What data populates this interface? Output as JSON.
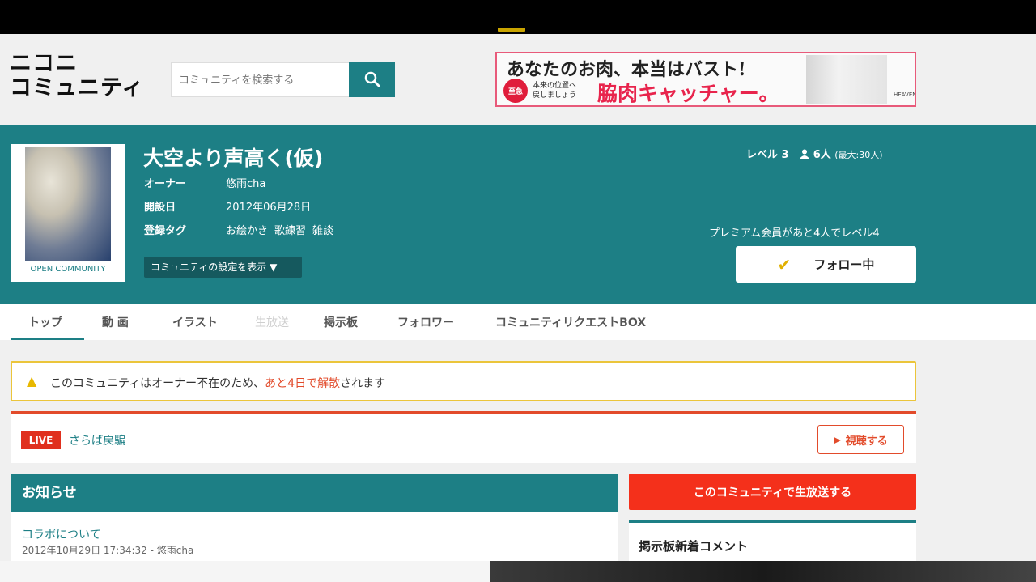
{
  "header": {
    "logo_line1": "ニコニ",
    "logo_line2": "コミュニティ",
    "search_placeholder": "コミュニティを検索する",
    "search_icon": "search-icon"
  },
  "ad": {
    "title": "あなたのお肉、本当はバスト!",
    "badge": "至急",
    "sub_line1": "本来の位置へ",
    "sub_line2": "戻しましょう",
    "cta": "脇肉キャッチャー。",
    "brand": "HEAVEN"
  },
  "community": {
    "title": "大空より声高く(仮)",
    "thumb_caption": "OPEN COMMUNITY",
    "owner_label": "オーナー",
    "owner": "悠雨cha",
    "founded_label": "開設日",
    "founded": "2012年06月28日",
    "tags_label": "登録タグ",
    "tags": [
      "お絵かき",
      "歌練習",
      "雑談"
    ],
    "settings_button": "コミュニティの設定を表示 ▼",
    "level": "レベル 3",
    "members": "6人",
    "members_max": "(最大:30人)",
    "premium_text": "プレミアム会員があと4人でレベル4",
    "follow_button": "フォロー中",
    "accent_color": "#1d7f85"
  },
  "tabs": [
    {
      "label": "トップ",
      "active": true
    },
    {
      "label": "動 画"
    },
    {
      "label": "イラスト"
    },
    {
      "label": "生放送",
      "disabled": true
    },
    {
      "label": "掲示板"
    },
    {
      "label": "フォロワー"
    },
    {
      "label": "コミュニティリクエストBOX"
    }
  ],
  "notice": {
    "before": "このコミュニティはオーナー不在のため、",
    "highlight": "あと4日で解散",
    "after": "されます"
  },
  "live": {
    "badge": "LIVE",
    "title": "さらば戻騙",
    "watch_button": "視聴する"
  },
  "news": {
    "heading": "お知らせ",
    "item_title": "コラボについて",
    "item_meta": "2012年10月29日 17:34:32 - 悠雨cha"
  },
  "sidebar": {
    "broadcast_button": "このコミュニティで生放送する",
    "bbs_title": "掲示板新着コメント"
  }
}
